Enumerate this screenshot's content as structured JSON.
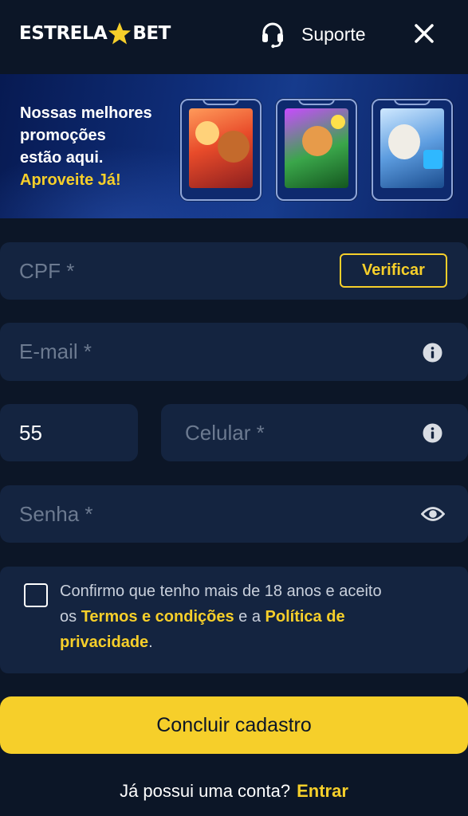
{
  "header": {
    "logo_left": "ESTRELA",
    "logo_right": "BET",
    "support_label": "Suporte"
  },
  "banner": {
    "line1": "Nossas melhores",
    "line2": "promoções",
    "line3": "estão aqui.",
    "highlight": "Aproveite Já!",
    "cards": [
      "game-card-1",
      "game-card-2",
      "game-card-3"
    ]
  },
  "form": {
    "cpf_placeholder": "CPF *",
    "verify_label": "Verificar",
    "email_placeholder": "E-mail *",
    "country_code": "55",
    "phone_placeholder": "Celular *",
    "password_placeholder": "Senha *"
  },
  "consent": {
    "line1": "Confirmo que tenho mais de 18 anos e aceito",
    "prefix2": "os ",
    "terms_link": "Termos e condições",
    "middle2": " e a ",
    "privacy_link_part1": "Política de",
    "privacy_link_part2": "privacidade",
    "suffix3": "."
  },
  "submit_label": "Concluir cadastro",
  "footer": {
    "question": "Já possui uma conta?",
    "login_link": "Entrar"
  },
  "colors": {
    "background": "#0c1627",
    "field": "#142440",
    "accent": "#f6cf2a"
  }
}
